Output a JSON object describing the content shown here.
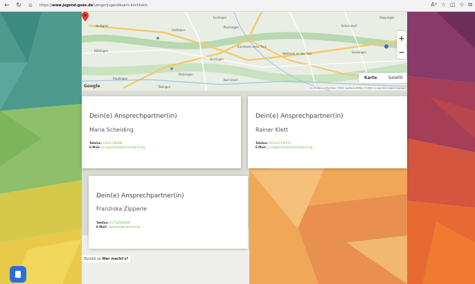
{
  "browser": {
    "url_prefix": "https://",
    "url_domain": "www.jugend-goes.de",
    "url_path": "/uenger/jugendbuero-kirchheim"
  },
  "map": {
    "type_map": "Karte",
    "type_satellite": "Satellit",
    "zoom_in": "+",
    "zoom_out": "−",
    "logo": "Google",
    "attribution": "Kurzbefehle   Kartendaten ©2024 GeoBasis-DE/BKG (©2009), Google   Nutzungsbedingungen",
    "places": [
      {
        "name": "Esslingen"
      },
      {
        "name": "Stuttgart"
      },
      {
        "name": "Ostfildern"
      },
      {
        "name": "Plochingen"
      },
      {
        "name": "Schorndorf"
      },
      {
        "name": "Kirchheim unter Teck"
      },
      {
        "name": "Göppingen"
      },
      {
        "name": "Nürtingen"
      },
      {
        "name": "Weilheim an der Teck"
      },
      {
        "name": "Böblingen"
      },
      {
        "name": "Metzingen"
      },
      {
        "name": "Reutlingen"
      },
      {
        "name": "Tübingen"
      },
      {
        "name": "Bad Urach"
      },
      {
        "name": "Geislingen"
      }
    ]
  },
  "cards": [
    {
      "title": "Dein(e) Ansprechpartner(in)",
      "name": "Maria Scheiding",
      "phone_label": "Telefon:",
      "phone": "07021738398",
      "email_label": "E-Mail:",
      "email": "jrs-e@kreisdiakonieverband.org"
    },
    {
      "title": "Dein(e) Ansprechpartner(in)",
      "name": "Rainer Klett",
      "phone_label": "Telefon:",
      "phone": "0151/27105970",
      "email_label": "E-Mail:",
      "email": "jrs-es@kreisdiakonieverband.org"
    },
    {
      "title": "Dein(e) Ansprechpartner(in)",
      "name": "Franziska Zipperle",
      "phone_label": "Telefon:",
      "phone": "0171/2958369",
      "email_label": "E-Mail:",
      "email": "f.zipperle@leubicom.de"
    }
  ],
  "back_link": {
    "prefix": "Zurück zu",
    "target": "Wer macht's?"
  }
}
